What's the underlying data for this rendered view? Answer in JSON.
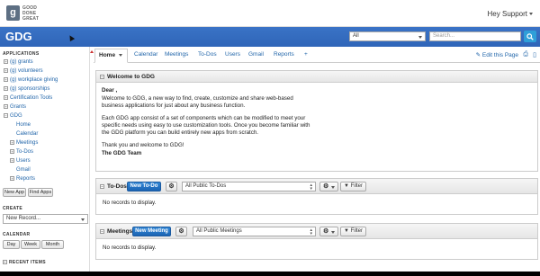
{
  "brand": {
    "logo_letter": "g",
    "logo_text": "GOOD DONE GREAT"
  },
  "user_menu": {
    "label": "Hey Support"
  },
  "header": {
    "app_title": "GDG",
    "scope_value": "All",
    "search_placeholder": "Search..."
  },
  "sidebar": {
    "applications_heading": "APPLICATIONS",
    "apps": [
      {
        "label": "(g) grants",
        "toggle": "+"
      },
      {
        "label": "(g) volunteers",
        "toggle": "+"
      },
      {
        "label": "(g) workplace giving",
        "toggle": "+"
      },
      {
        "label": "(g) sponsorships",
        "toggle": "+"
      },
      {
        "label": "Certification Tools",
        "toggle": "+"
      },
      {
        "label": "Grants",
        "toggle": "+"
      },
      {
        "label": "GDG",
        "toggle": "−"
      }
    ],
    "gdg_children": [
      {
        "label": "Home",
        "toggle": ""
      },
      {
        "label": "Calendar",
        "toggle": ""
      },
      {
        "label": "Meetings",
        "toggle": "+"
      },
      {
        "label": "To-Dos",
        "toggle": "+"
      },
      {
        "label": "Users",
        "toggle": "+"
      },
      {
        "label": "Gmail",
        "toggle": ""
      },
      {
        "label": "Reports",
        "toggle": "+"
      }
    ],
    "new_app_label": "New App",
    "find_apps_label": "Find Apps",
    "create_heading": "CREATE",
    "new_record_value": "New Record...",
    "calendar_heading": "CALENDAR",
    "day_label": "Day",
    "week_label": "Week",
    "month_label": "Month",
    "recent_heading": "RECENT ITEMS"
  },
  "tabs": {
    "home": "Home",
    "items": [
      "Calendar",
      "Meetings",
      "To-Dos",
      "Users",
      "Gmail",
      "Reports",
      "+"
    ],
    "edit_page": "Edit this Page"
  },
  "welcome": {
    "title": "Welcome to GDG",
    "greeting": "Dear ,",
    "p1": "Welcome to GDG, a new way to find, create, customize and share web-based business applications for just about any business function.",
    "p2": "Each GDG app consist of a set of components which can be modified to meet your specific needs using easy to use customization tools. Once you become familiar with the GDG platform you can build entirely new apps from scratch.",
    "p3": "Thank you and welcome to GDG!",
    "signoff": "The GDG Team"
  },
  "todos": {
    "label": "To-Dos",
    "new_label": "New To-Do",
    "view_value": "All Public To-Dos",
    "filter_label": "Filter",
    "empty_text": "No records to display."
  },
  "meetings": {
    "label": "Meetings",
    "new_label": "New Meeting",
    "view_value": "All Public Meetings",
    "filter_label": "Filter",
    "empty_text": "No records to display."
  },
  "icons": [
    "gdg-logo-icon",
    "search-icon",
    "gear-icon",
    "filter-icon",
    "print-icon",
    "pdf-icon",
    "edit-icon"
  ]
}
